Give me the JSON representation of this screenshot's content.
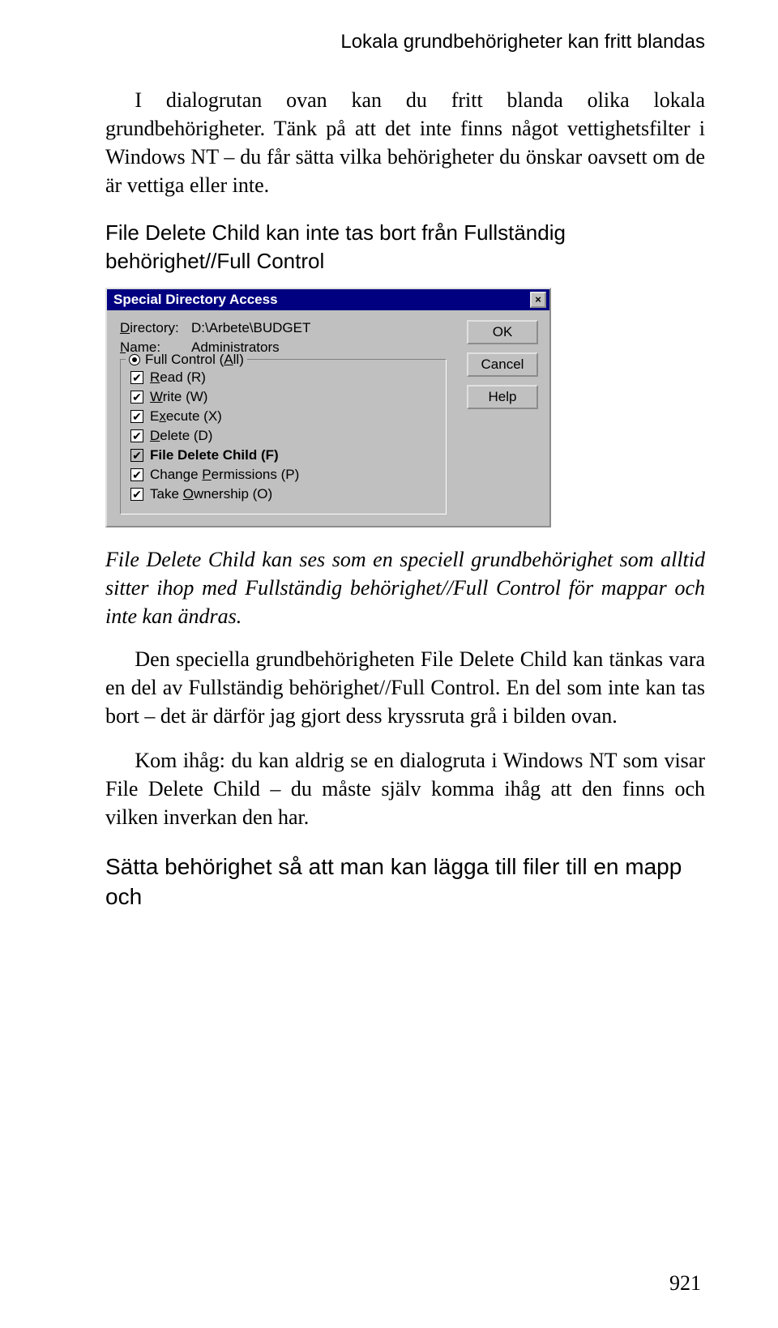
{
  "header": "Lokala grundbehörigheter kan fritt blandas",
  "para1": "I dialogrutan ovan kan du fritt blanda olika lokala grundbehörigheter. Tänk på att det inte finns något vettighetsfilter i Windows NT – du får sätta vilka behörigheter du önskar oavsett om de är vettiga eller inte.",
  "subheading": "File Delete Child kan inte tas bort från Fullständig behörighet//Full Control",
  "dialog": {
    "title": "Special Directory Access",
    "dir_label": "Directory:",
    "dir_value": "D:\\Arbete\\BUDGET",
    "name_label": "Name:",
    "name_value": "Administrators",
    "legend": "Full Control (All)",
    "options": [
      {
        "label": "Read (R)"
      },
      {
        "label": "Write (W)"
      },
      {
        "label": "Execute (X)"
      },
      {
        "label": "Delete (D)"
      },
      {
        "label": "File Delete Child (F)"
      },
      {
        "label": "Change Permissions (P)"
      },
      {
        "label": "Take Ownership (O)"
      }
    ],
    "buttons": {
      "ok": "OK",
      "cancel": "Cancel",
      "help": "Help"
    },
    "close": "×"
  },
  "caption": "File Delete Child kan ses som en speciell grundbehörighet som alltid sitter ihop med Fullständig behörighet//Full Control för mappar och inte kan ändras.",
  "para2": "Den speciella grundbehörigheten File Delete Child kan tänkas vara en del av Fullständig behörighet//Full Control. En del som inte kan tas bort – det är därför jag gjort dess kryssruta grå i bilden ovan.",
  "para3": "Kom ihåg: du kan aldrig se en dialogruta i Windows NT som visar File Delete Child – du måste själv komma ihåg att den finns och vilken inverkan den har.",
  "bottom_heading": "Sätta behörighet så att man kan lägga till filer till en mapp och",
  "page_number": "921"
}
